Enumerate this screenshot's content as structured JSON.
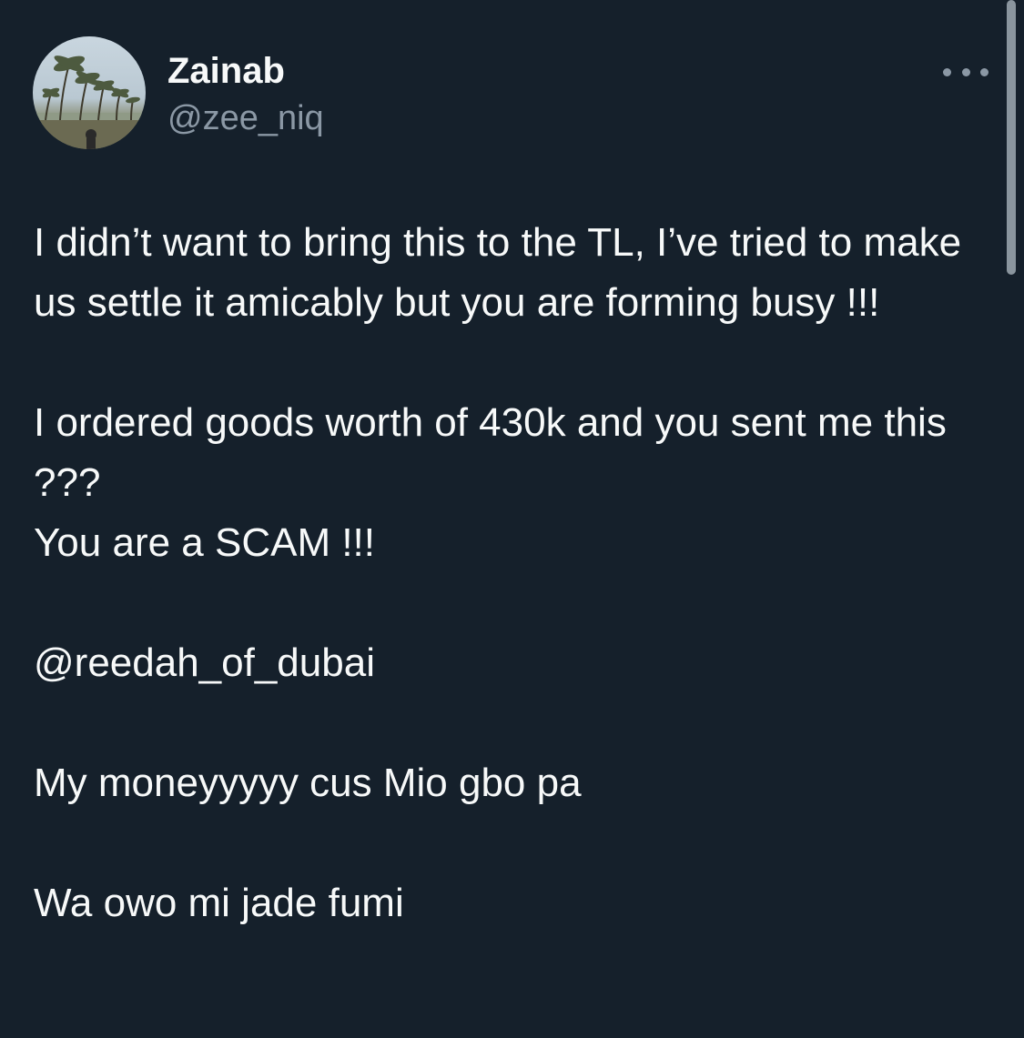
{
  "author": {
    "display_name": "Zainab",
    "handle": "@zee_niq"
  },
  "icons": {
    "more": "more-horizontal-icon",
    "avatar": "profile-photo-palm-trees"
  },
  "tweet": {
    "paragraphs": [
      "I didn’t want to bring this to the TL, I’ve tried to make us settle it amicably but you are forming busy !!!",
      "I ordered goods worth of 430k and you sent me this ???\nYou are a SCAM !!!",
      "@reedah_of_dubai",
      "My moneyyyyy cus Mio gbo pa",
      "Wa owo mi jade fumi"
    ]
  },
  "colors": {
    "background": "#15202b",
    "text_primary": "#f7f9f9",
    "text_secondary": "#8b98a5"
  }
}
